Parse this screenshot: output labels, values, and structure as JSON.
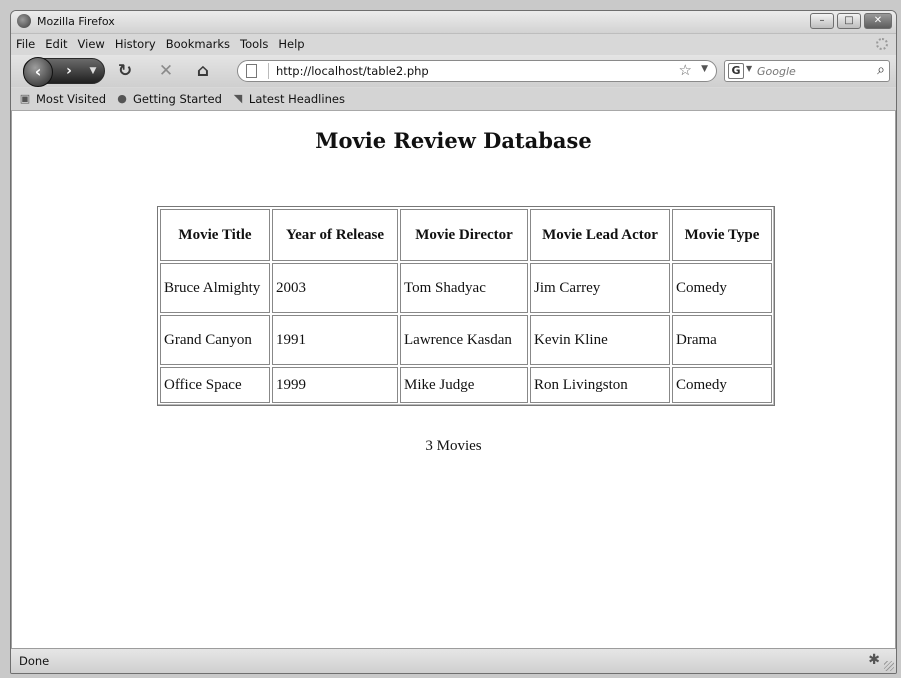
{
  "window": {
    "title": "Mozilla Firefox",
    "controls": {
      "minimize": "–",
      "maximize": "□",
      "close": "✕"
    }
  },
  "menu": [
    {
      "label": "File"
    },
    {
      "label": "Edit"
    },
    {
      "label": "View"
    },
    {
      "label": "History"
    },
    {
      "label": "Bookmarks"
    },
    {
      "label": "Tools"
    },
    {
      "label": "Help"
    }
  ],
  "navigation": {
    "url": "http://localhost/table2.php",
    "search_placeholder": "Google",
    "search_engine_glyph": "G"
  },
  "bookmarks": [
    {
      "label": "Most Visited",
      "icon": "bookmark-folder-icon"
    },
    {
      "label": "Getting Started",
      "icon": "firefox-icon"
    },
    {
      "label": "Latest Headlines",
      "icon": "rss-feed-icon"
    }
  ],
  "page": {
    "title": "Movie Review Database",
    "table": {
      "headers": [
        "Movie Title",
        "Year of Release",
        "Movie Director",
        "Movie Lead Actor",
        "Movie Type"
      ],
      "rows": [
        [
          "Bruce Almighty",
          "2003",
          "Tom Shadyac",
          "Jim Carrey",
          "Comedy"
        ],
        [
          "Grand Canyon",
          "1991",
          "Lawrence Kasdan",
          "Kevin Kline",
          "Drama"
        ],
        [
          "Office Space",
          "1999",
          "Mike Judge",
          "Ron Livingston",
          "Comedy"
        ]
      ]
    },
    "footer_count": "3 Movies"
  },
  "status": {
    "text": "Done"
  }
}
